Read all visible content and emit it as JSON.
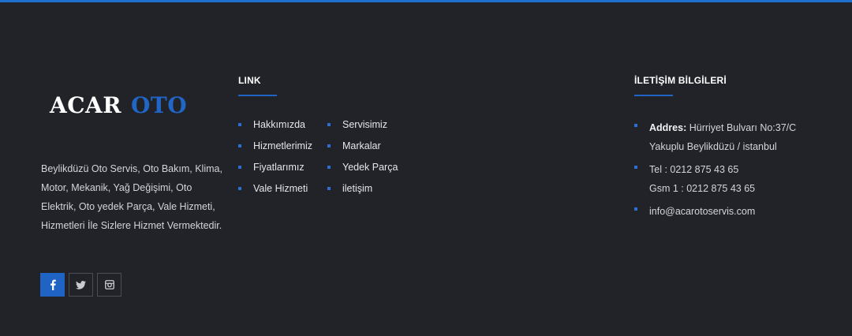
{
  "brand": {
    "word1": "ACAR",
    "word2": "OTO"
  },
  "about": "Beylikdüzü Oto Servis, Oto Bakım, Klima, Motor, Mekanik, Yağ Değişimi, Oto Elektrik, Oto yedek Parça, Vale Hizmeti, Hizmetleri İle Sizlere Hizmet Vermektedir.",
  "social": [
    {
      "icon": "facebook-icon",
      "active": true
    },
    {
      "icon": "twitter-icon",
      "active": false
    },
    {
      "icon": "instagram-icon",
      "active": false
    }
  ],
  "links": {
    "heading": "LINK",
    "left": [
      "Hakkımızda",
      "Hizmetlerimiz",
      "Fiyatlarımız",
      "Vale Hizmeti"
    ],
    "right": [
      "Servisimiz",
      "Markalar",
      "Yedek Parça",
      "iletişim"
    ]
  },
  "contact": {
    "heading": "İLETİŞİM BİLGİLERİ",
    "address_label": "Addres:",
    "address_line1": "Hürriyet Bulvarı No:37/C",
    "address_line2": "Yakuplu Beylikdüzü / istanbul",
    "tel": "Tel : 0212 875 43 65",
    "gsm": "Gsm 1 : 0212 875 43 65",
    "email": "info@acarotoservis.com"
  },
  "colors": {
    "accent": "#1f63c4",
    "background": "#212329"
  }
}
